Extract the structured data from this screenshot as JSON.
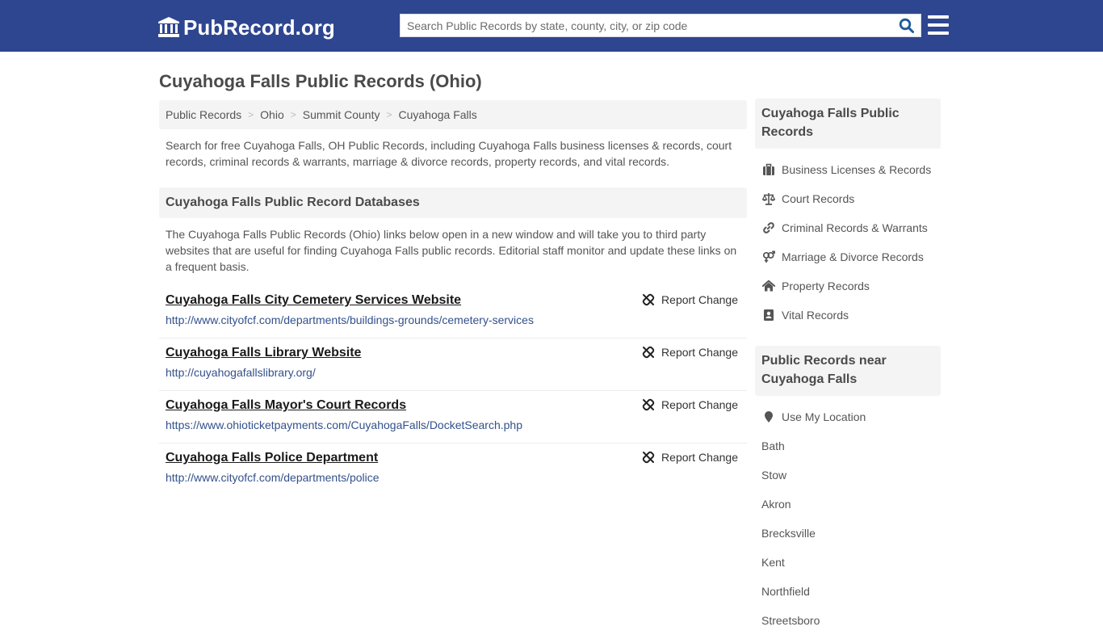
{
  "header": {
    "logo_text": "PubRecord.org",
    "search_placeholder": "Search Public Records by state, county, city, or zip code",
    "search_value": "",
    "brand_color": "#2e4690"
  },
  "page": {
    "title": "Cuyahoga Falls Public Records (Ohio)"
  },
  "breadcrumb": [
    {
      "label": "Public Records"
    },
    {
      "label": "Ohio"
    },
    {
      "label": "Summit County"
    },
    {
      "label": "Cuyahoga Falls"
    }
  ],
  "intro": "Search for free Cuyahoga Falls, OH Public Records, including Cuyahoga Falls business licenses & records, court records, criminal records & warrants, marriage & divorce records, property records, and vital records.",
  "databases": {
    "heading": "Cuyahoga Falls Public Record Databases",
    "description": "The Cuyahoga Falls Public Records (Ohio) links below open in a new window and will take you to third party websites that are useful for finding Cuyahoga Falls public records. Editorial staff monitor and update these links on a frequent basis.",
    "report_label": "Report Change",
    "records": [
      {
        "title": "Cuyahoga Falls City Cemetery Services Website",
        "url": "http://www.cityofcf.com/departments/buildings-grounds/cemetery-services"
      },
      {
        "title": "Cuyahoga Falls Library Website",
        "url": "http://cuyahogafallslibrary.org/"
      },
      {
        "title": "Cuyahoga Falls Mayor's Court Records",
        "url": "https://www.ohioticketpayments.com/CuyahogaFalls/DocketSearch.php"
      },
      {
        "title": "Cuyahoga Falls Police Department",
        "url": "http://www.cityofcf.com/departments/police"
      }
    ]
  },
  "sidebar": {
    "categories_heading": "Cuyahoga Falls Public Records",
    "categories": [
      {
        "label": "Business Licenses & Records",
        "icon": "briefcase-icon"
      },
      {
        "label": "Court Records",
        "icon": "scales-icon"
      },
      {
        "label": "Criminal Records & Warrants",
        "icon": "link-icon"
      },
      {
        "label": "Marriage & Divorce Records",
        "icon": "venus-mars-icon"
      },
      {
        "label": "Property Records",
        "icon": "home-icon"
      },
      {
        "label": "Vital Records",
        "icon": "address-book-icon"
      }
    ],
    "nearby_heading": "Public Records near Cuyahoga Falls",
    "use_location_label": "Use My Location",
    "nearby": [
      {
        "label": "Bath"
      },
      {
        "label": "Stow"
      },
      {
        "label": "Akron"
      },
      {
        "label": "Brecksville"
      },
      {
        "label": "Kent"
      },
      {
        "label": "Northfield"
      },
      {
        "label": "Streetsboro"
      }
    ]
  }
}
